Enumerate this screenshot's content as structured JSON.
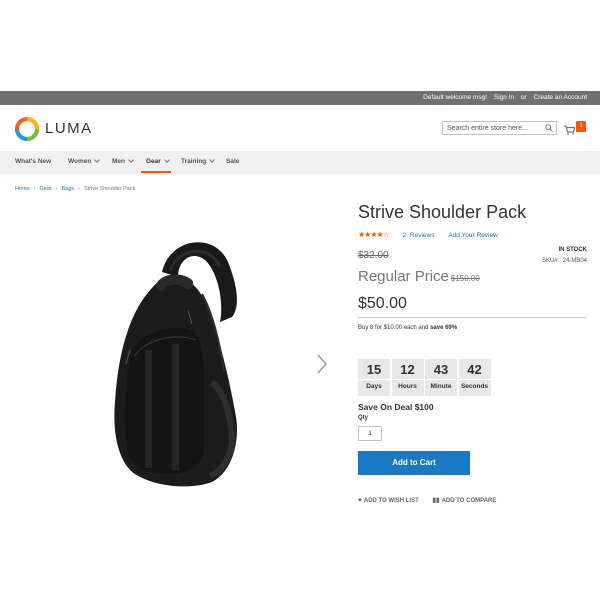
{
  "topbar": {
    "welcome": "Default welcome msg!",
    "sign_in": "Sign In",
    "or": "or",
    "create_account": "Create an Account"
  },
  "header": {
    "logo_text": "LUMA",
    "search_placeholder": "Search entire store here...",
    "cart_count": "1"
  },
  "nav": {
    "items": [
      "What's New",
      "Women",
      "Men",
      "Gear",
      "Training",
      "Sale"
    ],
    "active": "Gear"
  },
  "breadcrumb": [
    "Home",
    "Gear",
    "Bags",
    "Strive Shoulder Pack"
  ],
  "product": {
    "title": "Strive Shoulder Pack",
    "rating_stars": 4,
    "reviews_count": "2",
    "reviews_label": "Reviews",
    "add_review": "Add Your Review",
    "stock": "IN STOCK",
    "sku_label": "SKU#:",
    "sku": "24-MB04",
    "old_price": "$32.00",
    "regular_label": "Regular Price",
    "regular_old": "$150.00",
    "final_price": "$50.00",
    "tier_text": "Buy 8 for $10.00 each and ",
    "tier_save": "save 69%"
  },
  "countdown": [
    {
      "value": "15",
      "label": "Days"
    },
    {
      "value": "12",
      "label": "Hours"
    },
    {
      "value": "43",
      "label": "Minute"
    },
    {
      "value": "42",
      "label": "Seconds"
    }
  ],
  "deal": "Save On Deal $100",
  "qty": {
    "label": "Qty",
    "value": "1"
  },
  "add_to_cart": "Add to Cart",
  "actions": {
    "wishlist": "ADD TO WISH LIST",
    "compare": "ADD TO COMPARE"
  },
  "colors": {
    "accent": "#ff5501",
    "link": "#1979c3",
    "topbar": "#6e716e",
    "nav_bg": "#f0f0f0"
  }
}
